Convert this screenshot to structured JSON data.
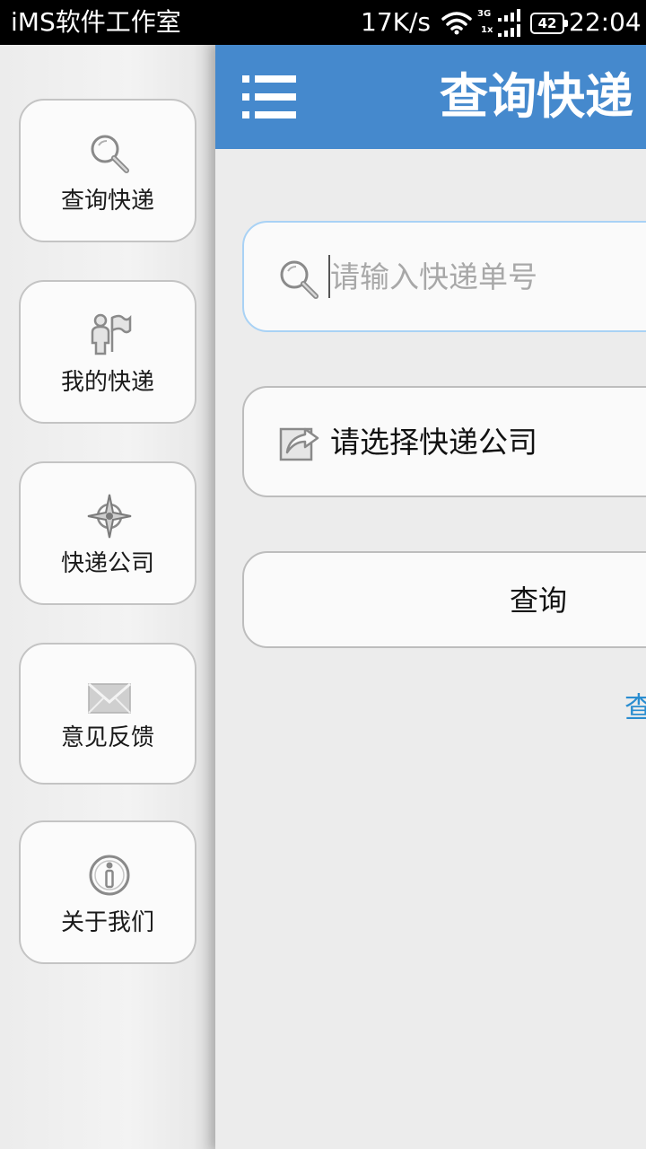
{
  "status_bar": {
    "app_name": "iMS软件工作室",
    "net_speed": "17K/s",
    "signal_3g": "3G",
    "signal_1x": "1x",
    "battery": "42",
    "time": "22:04"
  },
  "drawer": {
    "items": [
      {
        "label": "查询快递",
        "icon": "search-icon"
      },
      {
        "label": "我的快递",
        "icon": "person-flag-icon"
      },
      {
        "label": "快递公司",
        "icon": "compass-icon"
      },
      {
        "label": "意见反馈",
        "icon": "envelope-icon"
      },
      {
        "label": "关于我们",
        "icon": "info-icon"
      }
    ]
  },
  "header": {
    "title": "查询快递",
    "menu_icon": "list-menu-icon",
    "color": "#4589cd"
  },
  "search": {
    "placeholder": "请输入快递单号",
    "value": "",
    "icon": "search-icon"
  },
  "company": {
    "label": "请选择快递公司",
    "icon": "edit-share-icon"
  },
  "query_button": {
    "label": "查询"
  },
  "history_link": {
    "label": "查"
  },
  "colors": {
    "accent": "#4589cd",
    "link": "#2a8dd0",
    "focus_border": "#a9d2f5"
  }
}
